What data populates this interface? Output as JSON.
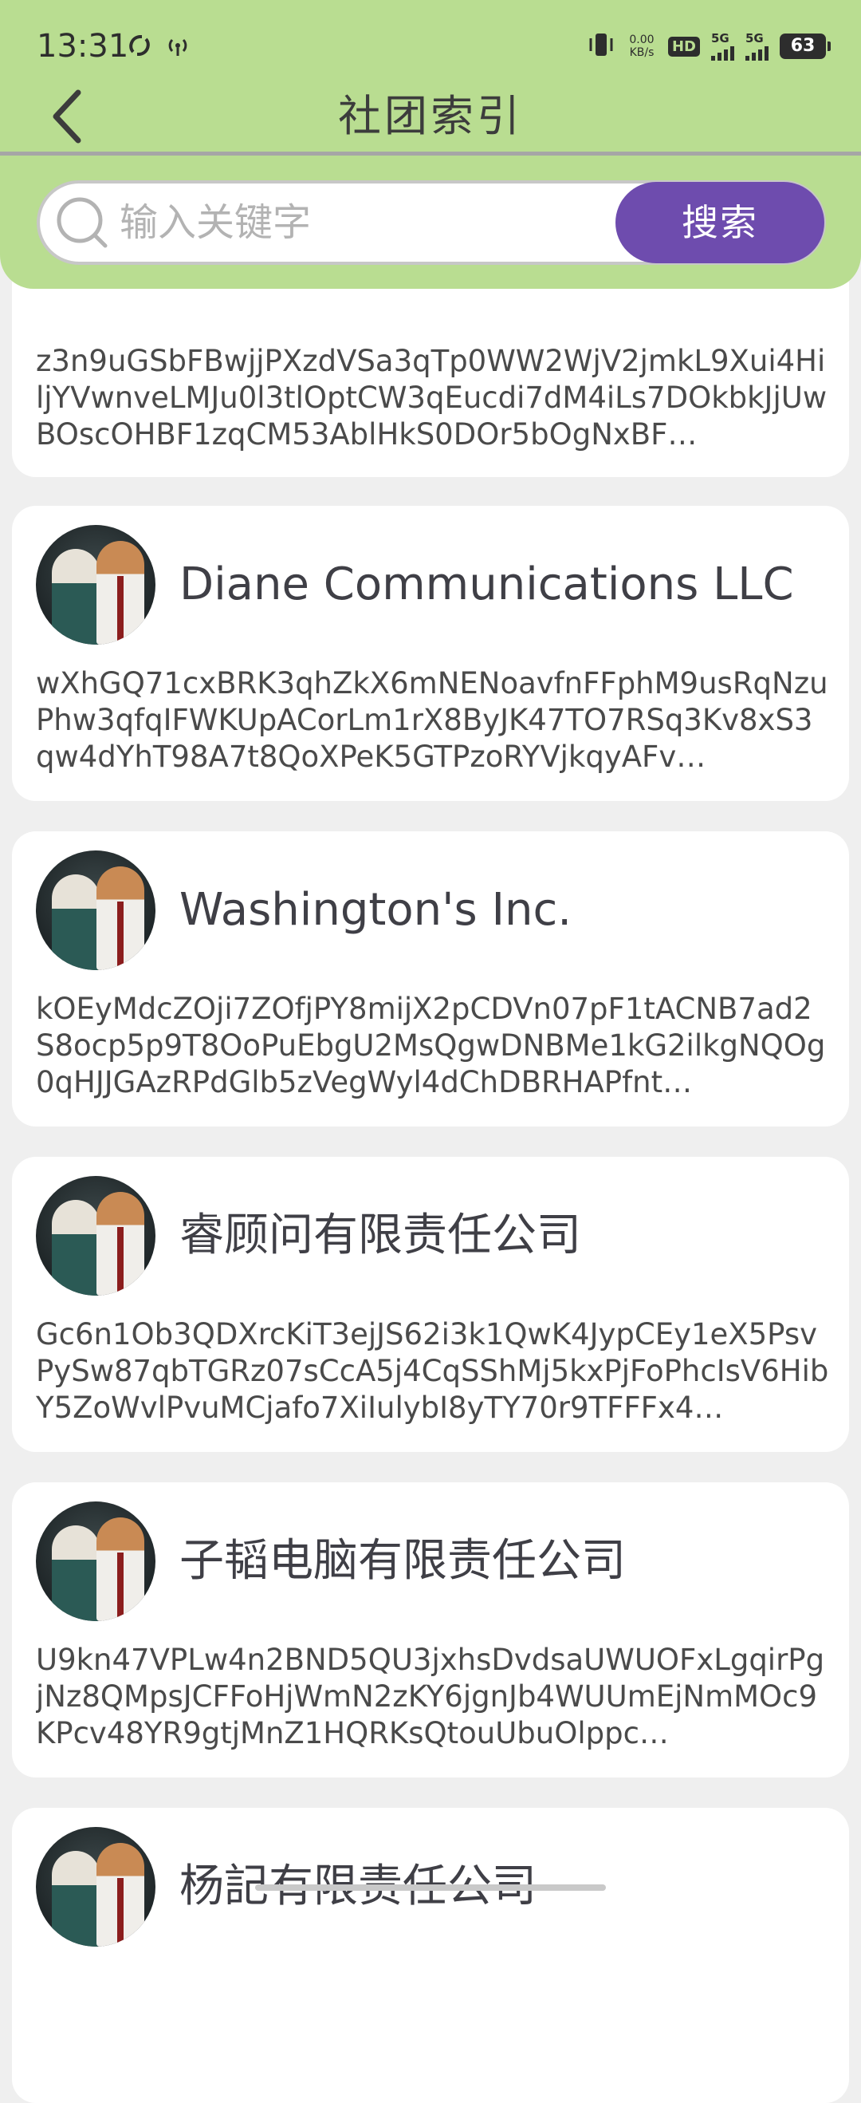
{
  "status_bar": {
    "time": "13:31",
    "net_speed_value": "0.00",
    "net_speed_unit": "KB/s",
    "hd_label": "HD",
    "sim1_label": "5G",
    "sim2_label": "5G",
    "battery": "63"
  },
  "header": {
    "title": "社团索引",
    "search_placeholder": "输入关键字",
    "search_button": "搜索"
  },
  "clubs": [
    {
      "name": "",
      "desc": "z3n9uGSbFBwjjPXzdVSa3qTp0WW2WjV2jmkL9Xui4HiljYVwnveLMJu0l3tlOptCW3qEucdi7dM4iLs7DOkbkJjUwBOscOHBF1zqCM53AblHkS0DOr5bOgNxBF…"
    },
    {
      "name": "Diane Communications LLC",
      "desc": "wXhGQ71cxBRK3qhZkX6mNENoavfnFFphM9usRqNzuPhw3qfqIFWKUpACorLm1rX8ByJK47TO7RSq3Kv8xS3qw4dYhT98A7t8QoXPeK5GTPzoRYVjkqyAFv…"
    },
    {
      "name": "Washington's Inc.",
      "desc": "kOEyMdcZOji7ZOfjPY8mijX2pCDVn07pF1tACNB7ad2S8ocp5p9T8OoPuEbgU2MsQgwDNBMe1kG2ilkgNQOg0qHJJGAzRPdGlb5zVegWyl4dChDBRHAPfnt…"
    },
    {
      "name": "睿顾问有限责任公司",
      "desc": "Gc6n1Ob3QDXrcKiT3ejJS62i3k1QwK4JypCEy1eX5PsvPySw87qbTGRz07sCcA5j4CqSShMj5kxPjFoPhcIsV6HibY5ZoWvlPvuMCjafo7XiIulybI8yTY70r9TFFFx4…"
    },
    {
      "name": "子韬电脑有限责任公司",
      "desc": "U9kn47VPLw4n2BND5QU3jxhsDvdsaUWUOFxLgqirPgjNz8QMpsJCFFoHjWmN2zKY6jgnJb4WUUmEjNmMOc9KPcv48YR9gtjMnZ1HQRKsQtouUbuOlppc…"
    },
    {
      "name": "杨記有限责任公司",
      "desc": ""
    }
  ],
  "colors": {
    "header_bg": "#b9dd91",
    "accent": "#6e4cae",
    "page_bg": "#efefef"
  }
}
